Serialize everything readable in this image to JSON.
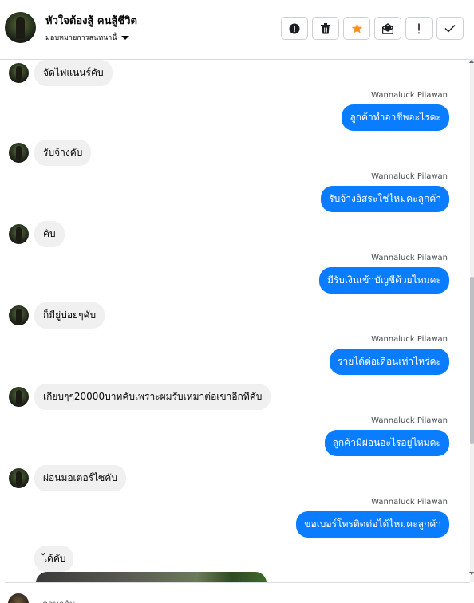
{
  "header": {
    "name": "หัวใจต้องสู้ คนสู้ชีวิต",
    "assign_label": "มอบหมายการสนทนานี้",
    "actions": [
      {
        "icon": "alert-circle-icon"
      },
      {
        "icon": "trash-icon"
      },
      {
        "icon": "star-icon",
        "color": "#f7931e"
      },
      {
        "icon": "mail-icon"
      },
      {
        "icon": "exclamation-icon"
      },
      {
        "icon": "check-icon"
      }
    ]
  },
  "messages": [
    {
      "dir": "in",
      "text": "จัดไฟแนนร์คับ"
    },
    {
      "dir": "out",
      "sender": "Wannaluck Pilawan",
      "text": "ลูกค้าทำอาชีพอะไรคะ"
    },
    {
      "dir": "in",
      "text": "รับจ้างคับ"
    },
    {
      "dir": "out",
      "sender": "Wannaluck Pilawan",
      "text": "รับจ้างอิสระใช่ไหมคะลูกค้า"
    },
    {
      "dir": "in",
      "text": "คับ"
    },
    {
      "dir": "out",
      "sender": "Wannaluck Pilawan",
      "text": "มีรับเงินเข้าบัญชีด้วยไหมคะ"
    },
    {
      "dir": "in",
      "text": "ก็มียู่บ่อยๆคับ"
    },
    {
      "dir": "out",
      "sender": "Wannaluck Pilawan",
      "text": "รายได้ต่อเดือนเท่าไหร่คะ"
    },
    {
      "dir": "in",
      "text": "เกียบๆๆ20000บาทคับเพราะผมรับเหมาต่อเขาอีกทีคับ"
    },
    {
      "dir": "out",
      "sender": "Wannaluck Pilawan",
      "text": "ลูกค้ามีผ่อนอะไรอยู่ไหมคะ"
    },
    {
      "dir": "in",
      "text": "ผ่อนมอเตอร์ไซคับ"
    },
    {
      "dir": "out",
      "sender": "Wannaluck Pilawan",
      "text": "ขอเบอร์โทรติดต่อได้ไหมคะลูกค้า"
    },
    {
      "dir": "in-plain",
      "text": "ได้คับ"
    }
  ],
  "composer": {
    "placeholder": "ตอบกลับ..."
  },
  "colors": {
    "outgoing_bubble": "#0a7cff",
    "incoming_bubble": "#f0f0f0",
    "star": "#f7931e"
  }
}
